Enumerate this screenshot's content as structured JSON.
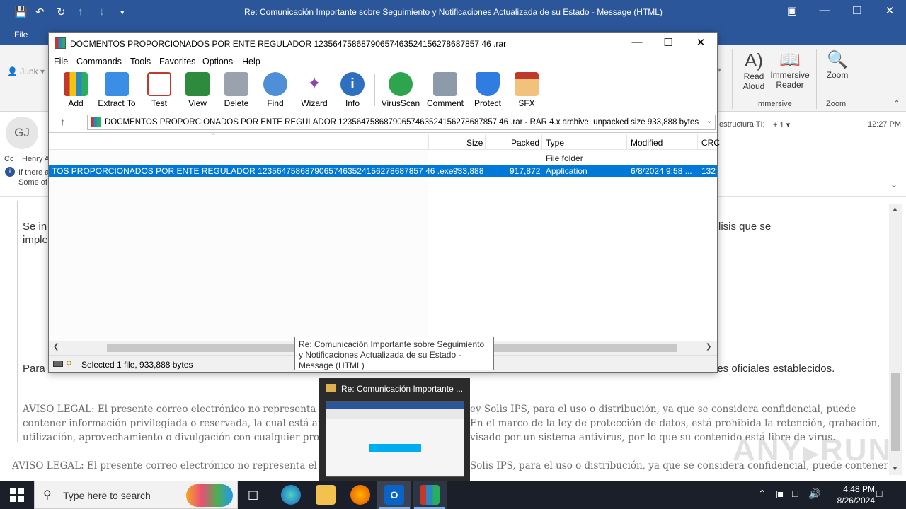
{
  "outlook": {
    "title": "Re: Comunicación Importante sobre Seguimiento y Notificaciones Actualizada de su Estado  -  Message (HTML)",
    "file_tab": "File",
    "junk": "Junk",
    "ribbon_buttons": [
      {
        "label": "Read Aloud",
        "l1": "Read",
        "l2": "Aloud"
      },
      {
        "label": "Immersive Reader",
        "l1": "Immersive",
        "l2": "Reader"
      },
      {
        "label": "Zoom",
        "l1": "Zoom",
        "l2": ""
      }
    ],
    "group_immersive": "Immersive",
    "group_zoom": "Zoom",
    "avatar_initials": "GJ",
    "cc_label": "Cc",
    "cc_name": "Henry A",
    "info_line1": "If there a",
    "info_line2": "Some of",
    "recipients_tail": "estructura TI;",
    "recipients_more": "+ 1",
    "time": "12:27 PM",
    "body_para1_start": "Se in",
    "body_para1_start2": "imple",
    "body_para1_end": "lisis que se",
    "body_para2_start": "Para",
    "body_para2_end": "les oficiales establecidos.",
    "legal_1_a": "AVISO LEGAL: El presente correo electrónico no representa e",
    "legal_1_b": "ey Solis IPS, para el uso o distribución, ya que se considera confidencial, puede",
    "legal_2_a": "contener información privilegiada o reservada, la cual está au",
    "legal_2_b": "En el marco de la ley de protección de datos, está prohibida la retención, grabación,",
    "legal_3_a": "utilización, aprovechamiento o divulgación con cualquier pro",
    "legal_3_b": "visado por un sistema antivirus, por lo que su contenido está libre de virus.",
    "legal_4_a": "AVISO LEGAL: El presente correo electrónico no representa el c",
    "legal_4_b": "Solis IPS, para el uso o distribución, ya que se considera confidencial, puede contener"
  },
  "winrar": {
    "title": "DOCMENTOS PROPORCIONADOS POR ENTE REGULADOR 12356475868790657463524156278687857 46 .rar",
    "menu": [
      "File",
      "Commands",
      "Tools",
      "Favorites",
      "Options",
      "Help"
    ],
    "tools": [
      "Add",
      "Extract To",
      "Test",
      "View",
      "Delete",
      "Find",
      "Wizard",
      "Info",
      "VirusScan",
      "Comment",
      "Protect",
      "SFX"
    ],
    "address": "DOCMENTOS PROPORCIONADOS POR ENTE REGULADOR 12356475868790657463524156278687857 46 .rar - RAR 4.x archive, unpacked size 933,888 bytes",
    "columns": {
      "size": "Size",
      "packed": "Packed",
      "type": "Type",
      "modified": "Modified",
      "crc": "CRC"
    },
    "rows": [
      {
        "name": "",
        "size": "",
        "packed": "",
        "type": "File folder",
        "modified": "",
        "crc": ""
      },
      {
        "name": "TOS PROPORCIONADOS POR ENTE REGULADOR 12356475868790657463524156278687857 46 .exe *",
        "size": "933,888",
        "packed": "917,872",
        "type": "Application",
        "modified": "6/8/2024 9:58 ...",
        "crc": "132"
      }
    ],
    "status": "Selected 1 file, 933,888 bytes"
  },
  "tooltip": {
    "text": "Re: Comunicación Importante sobre Seguimiento y Notificaciones Actualizada de su Estado - Message (HTML)"
  },
  "preview": {
    "title": "Re: Comunicación Importante ..."
  },
  "taskbar": {
    "search_placeholder": "Type here to search",
    "time": "4:48 PM",
    "date": "8/26/2024"
  },
  "watermark": "ANY.RUN",
  "colors": {
    "outlook_blue": "#2b579a",
    "selection": "#0078d7",
    "taskbar": "#1b1f2a"
  }
}
